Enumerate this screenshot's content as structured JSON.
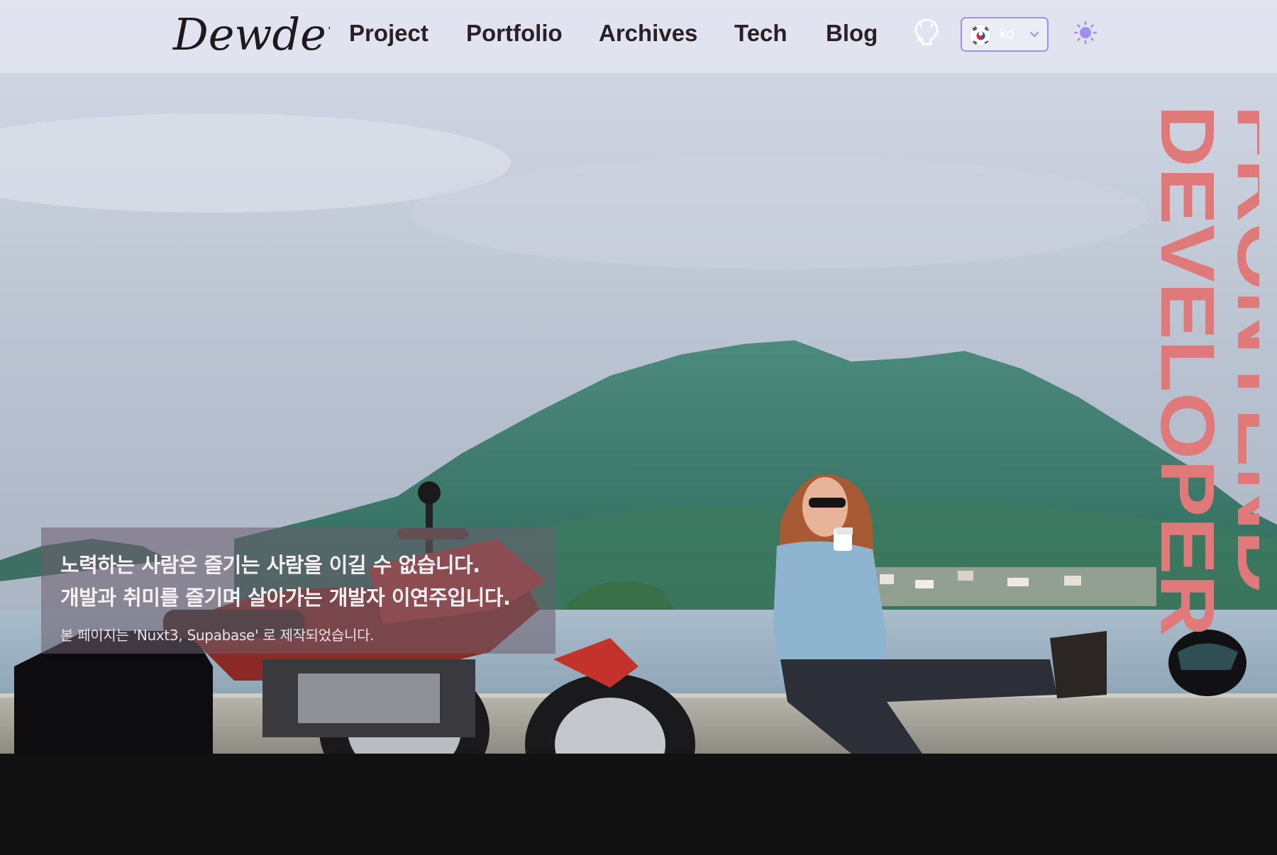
{
  "header": {
    "logo_text": "Dewdew",
    "nav": {
      "project": "Project",
      "portfolio": "Portfolio",
      "archives": "Archives",
      "tech": "Tech",
      "blog": "Blog"
    },
    "github_icon": "github-icon",
    "language": {
      "flag_icon": "south-korea-flag-icon",
      "value": "ko",
      "chevron_icon": "chevron-down-icon"
    },
    "theme_icon": "sun-icon"
  },
  "hero": {
    "vertical_title": {
      "line1": "FRONTEND",
      "line2": "DEVELOPER",
      "gradient_colors": [
        "#e07a7a",
        "#c98a8a",
        "#9aa8a2",
        "#2bb5a8"
      ]
    },
    "intro": {
      "line1": "노력하는 사람은 즐기는 사람을 이길 수 없습니다.",
      "line2": "개발과 취미를 즐기며 살아가는 개발자 이연주입니다.",
      "note": "본 페이지는 'Nuxt3, Supabase' 로 제작되었습니다."
    }
  },
  "colors": {
    "accent_border": "#a38ef0",
    "theme_icon": "#a38ef0",
    "nav_text": "#2a2026",
    "page_bottom": "#111111"
  }
}
